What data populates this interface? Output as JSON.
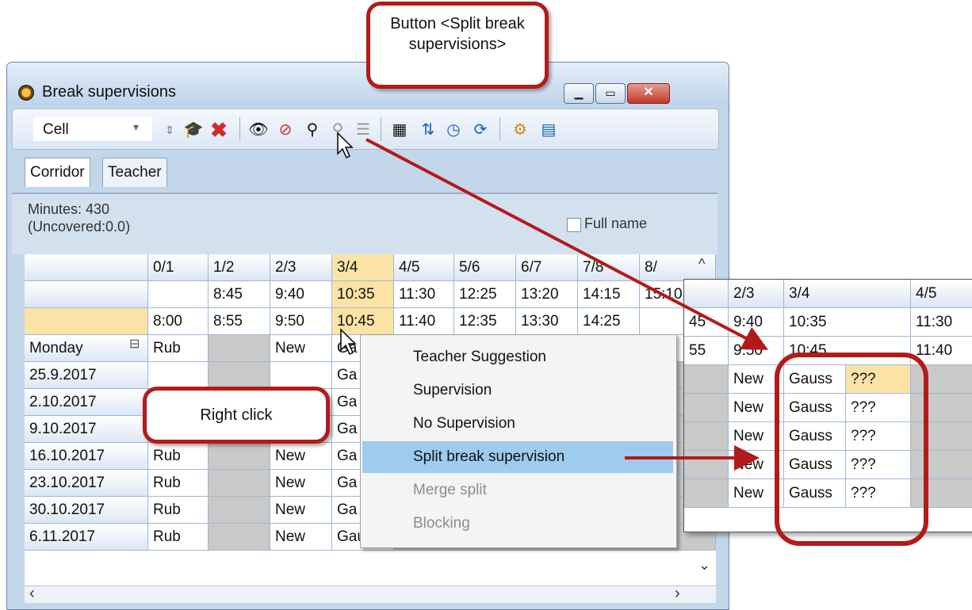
{
  "window": {
    "title": "Break supervisions",
    "controls": {
      "minimize": "▭",
      "maximize": "▭",
      "close": "✕"
    }
  },
  "toolbar": {
    "view_combo": "Cell",
    "icons": [
      "spin-icon",
      "graduation-cap-icon",
      "delete-icon",
      "eye-icon",
      "eye-crossed-icon",
      "split-supervision-icon",
      "merge-split-icon",
      "list-icon",
      "calculator-icon",
      "sort-icon",
      "clock-icon",
      "refresh-icon",
      "gear-icon",
      "settings-report-icon"
    ]
  },
  "tabs": [
    "Corridor",
    "Teacher"
  ],
  "info": {
    "minutes": "Minutes: 430",
    "uncovered": "(Uncovered:0.0)",
    "full_name_label": "Full name"
  },
  "grid": {
    "periods": [
      "0/1",
      "1/2",
      "2/3",
      "3/4",
      "4/5",
      "5/6",
      "6/7",
      "7/8",
      "8/"
    ],
    "start_times": [
      "",
      "8:45",
      "9:40",
      "10:35",
      "11:30",
      "12:25",
      "13:20",
      "14:15",
      "15:10"
    ],
    "end_times": [
      "8:00",
      "8:55",
      "9:50",
      "10:45",
      "11:40",
      "12:35",
      "13:30",
      "14:25",
      ""
    ],
    "rows": [
      {
        "label": "Monday",
        "cells": [
          "Rub",
          "",
          "New",
          "Ga"
        ],
        "collapse": "⊟"
      },
      {
        "label": "25.9.2017",
        "cells": [
          "",
          "",
          "",
          "Ga"
        ]
      },
      {
        "label": "2.10.2017",
        "cells": [
          "",
          "",
          "",
          "Ga"
        ]
      },
      {
        "label": "9.10.2017",
        "cells": [
          "",
          "",
          "",
          "Ga"
        ]
      },
      {
        "label": "16.10.2017",
        "cells": [
          "Rub",
          "",
          "New",
          "Ga"
        ]
      },
      {
        "label": "23.10.2017",
        "cells": [
          "Rub",
          "",
          "New",
          "Ga"
        ]
      },
      {
        "label": "30.10.2017",
        "cells": [
          "Rub",
          "",
          "New",
          "Ga"
        ]
      },
      {
        "label": "6.11.2017",
        "cells": [
          "Rub",
          "",
          "New",
          "Gauss"
        ]
      }
    ]
  },
  "context_menu": {
    "items": [
      {
        "label": "Teacher Suggestion",
        "state": "normal"
      },
      {
        "label": "Supervision",
        "state": "normal"
      },
      {
        "label": "No Supervision",
        "state": "normal"
      },
      {
        "label": "Split break supervision",
        "state": "selected"
      },
      {
        "label": "Merge split",
        "state": "disabled"
      },
      {
        "label": "Blocking",
        "state": "disabled"
      }
    ]
  },
  "zoom_panel": {
    "periods": [
      "2/3",
      "3/4",
      "4/5"
    ],
    "start_times": [
      "9:40",
      "10:35",
      "11:30"
    ],
    "end_times": [
      "9:50",
      "10:45",
      "11:40"
    ],
    "left_edge": [
      "45",
      "55"
    ],
    "rows": [
      {
        "c1": "New",
        "c2": "Gauss",
        "c3": "???"
      },
      {
        "c1": "New",
        "c2": "Gauss",
        "c3": "???"
      },
      {
        "c1": "New",
        "c2": "Gauss",
        "c3": "???"
      },
      {
        "c1": "New",
        "c2": "Gauss",
        "c3": "???"
      },
      {
        "c1": "New",
        "c2": "Gauss",
        "c3": "???"
      }
    ]
  },
  "callouts": {
    "button_callout": "Button <Split break supervisions>",
    "right_click": "Right click"
  },
  "colors": {
    "accent_red": "#b41a1a",
    "highlight": "#fbe3a5",
    "menu_selected": "#9fcbee"
  }
}
